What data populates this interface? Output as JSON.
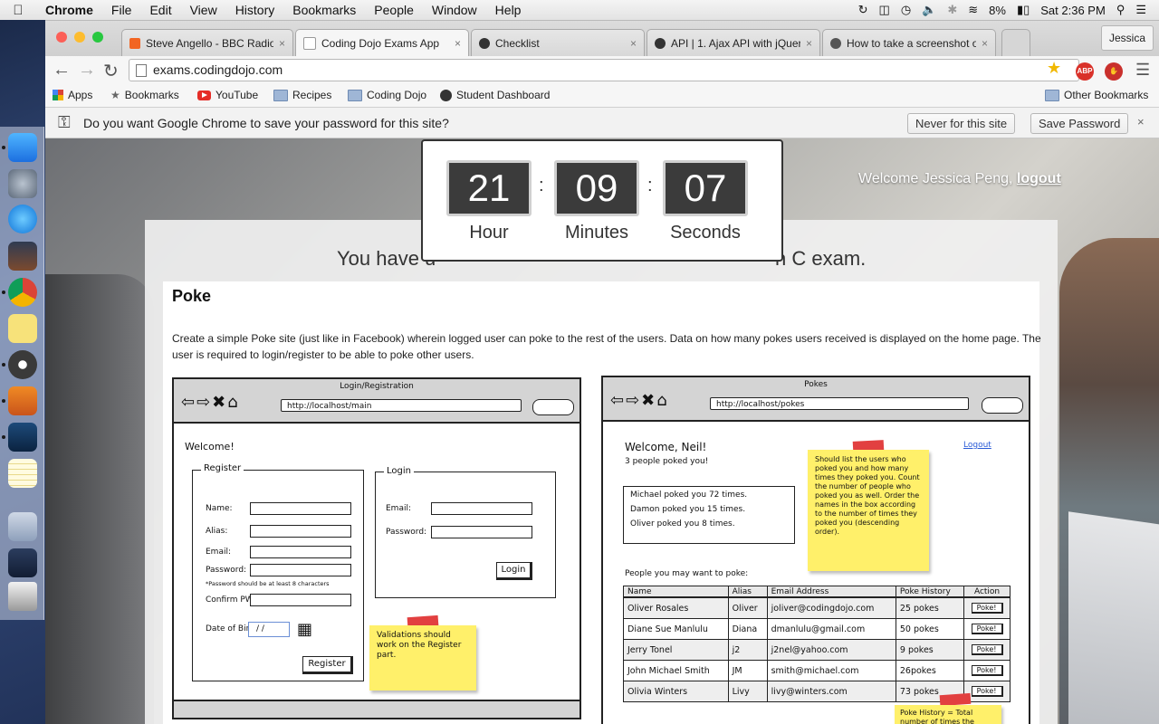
{
  "menubar": {
    "app": "Chrome",
    "items": [
      "File",
      "Edit",
      "View",
      "History",
      "Bookmarks",
      "People",
      "Window",
      "Help"
    ],
    "battery": "8%",
    "clock": "Sat 2:36 PM"
  },
  "browser": {
    "tabs": [
      {
        "title": "Steve Angello - BBC Radio",
        "close": "×"
      },
      {
        "title": "Coding Dojo Exams App",
        "close": "×"
      },
      {
        "title": "Checklist",
        "close": "×"
      },
      {
        "title": "API | 1. Ajax API with jQuer",
        "close": "×"
      },
      {
        "title": "How to take a screenshot o",
        "close": "×"
      }
    ],
    "profile": "Jessica",
    "url": "exams.codingdojo.com",
    "bookmarks": [
      "Apps",
      "Bookmarks",
      "YouTube",
      "Recipes",
      "Coding Dojo",
      "Student Dashboard"
    ],
    "other_bookmarks": "Other Bookmarks",
    "password_bar": {
      "message": "Do you want Google Chrome to save your password for this site?",
      "never": "Never for this site",
      "save": "Save Password",
      "close": "×"
    }
  },
  "page": {
    "welcome": "Welcome Jessica Peng,",
    "logout": "logout",
    "banner_left": "You have u",
    "banner_right": "n C exam.",
    "title": "Poke",
    "description": "Create a simple Poke site (just like in Facebook) wherein logged user can poke to the rest of the users. Data on how many pokes users received is displayed on the home page. The user is required to login/register to be able to poke other users."
  },
  "timer": {
    "hours": "21",
    "minutes": "09",
    "seconds": "07",
    "hour_label": "Hour",
    "minutes_label": "Minutes",
    "seconds_label": "Seconds",
    "separator": ":"
  },
  "mock_login": {
    "title": "Login/Registration",
    "url": "http://localhost/main",
    "welcome": "Welcome!",
    "register_legend": "Register",
    "login_legend": "Login",
    "register_labels": {
      "name": "Name:",
      "alias": "Alias:",
      "email": "Email:",
      "password": "Password:",
      "password_note": "*Password should be at least 8 characters",
      "confirm": "Confirm PW:",
      "dob": "Date of Birth:"
    },
    "dob_value": "/ /",
    "register_button": "Register",
    "login_labels": {
      "email": "Email:",
      "password": "Password:"
    },
    "login_button": "Login",
    "note": "Validations should work on the Register part."
  },
  "mock_pokes": {
    "title": "Pokes",
    "url": "http://localhost/pokes",
    "welcome": "Welcome, Neil!",
    "poked_count": "3 people poked you!",
    "logout": "Logout",
    "poked_by": [
      "Michael poked you 72 times.",
      "Damon poked you 15 times.",
      "Oliver poked you 8 times."
    ],
    "note1": "Should list the users who poked you and how many times they poked you. Count the number of people who poked you as well. Order the names in the box according to the number of times they poked you (descending order).",
    "may_poke": "People you may want to poke:",
    "columns": [
      "Name",
      "Alias",
      "Email Address",
      "Poke History",
      "Action"
    ],
    "rows": [
      [
        "Oliver Rosales",
        "Oliver",
        "joliver@codingdojo.com",
        "25 pokes",
        "Poke!"
      ],
      [
        "Diane Sue Manlulu",
        "Diana",
        "dmanlulu@gmail.com",
        "50 pokes",
        "Poke!"
      ],
      [
        "Jerry Tonel",
        "j2",
        "j2nel@yahoo.com",
        "9 pokes",
        "Poke!"
      ],
      [
        "John Michael Smith",
        "JM",
        "smith@michael.com",
        "26pokes",
        "Poke!"
      ],
      [
        "Olivia Winters",
        "Livy",
        "livy@winters.com",
        "73 pokes",
        "Poke!"
      ]
    ],
    "note2": "Poke History = Total number of times the person has been poked."
  }
}
